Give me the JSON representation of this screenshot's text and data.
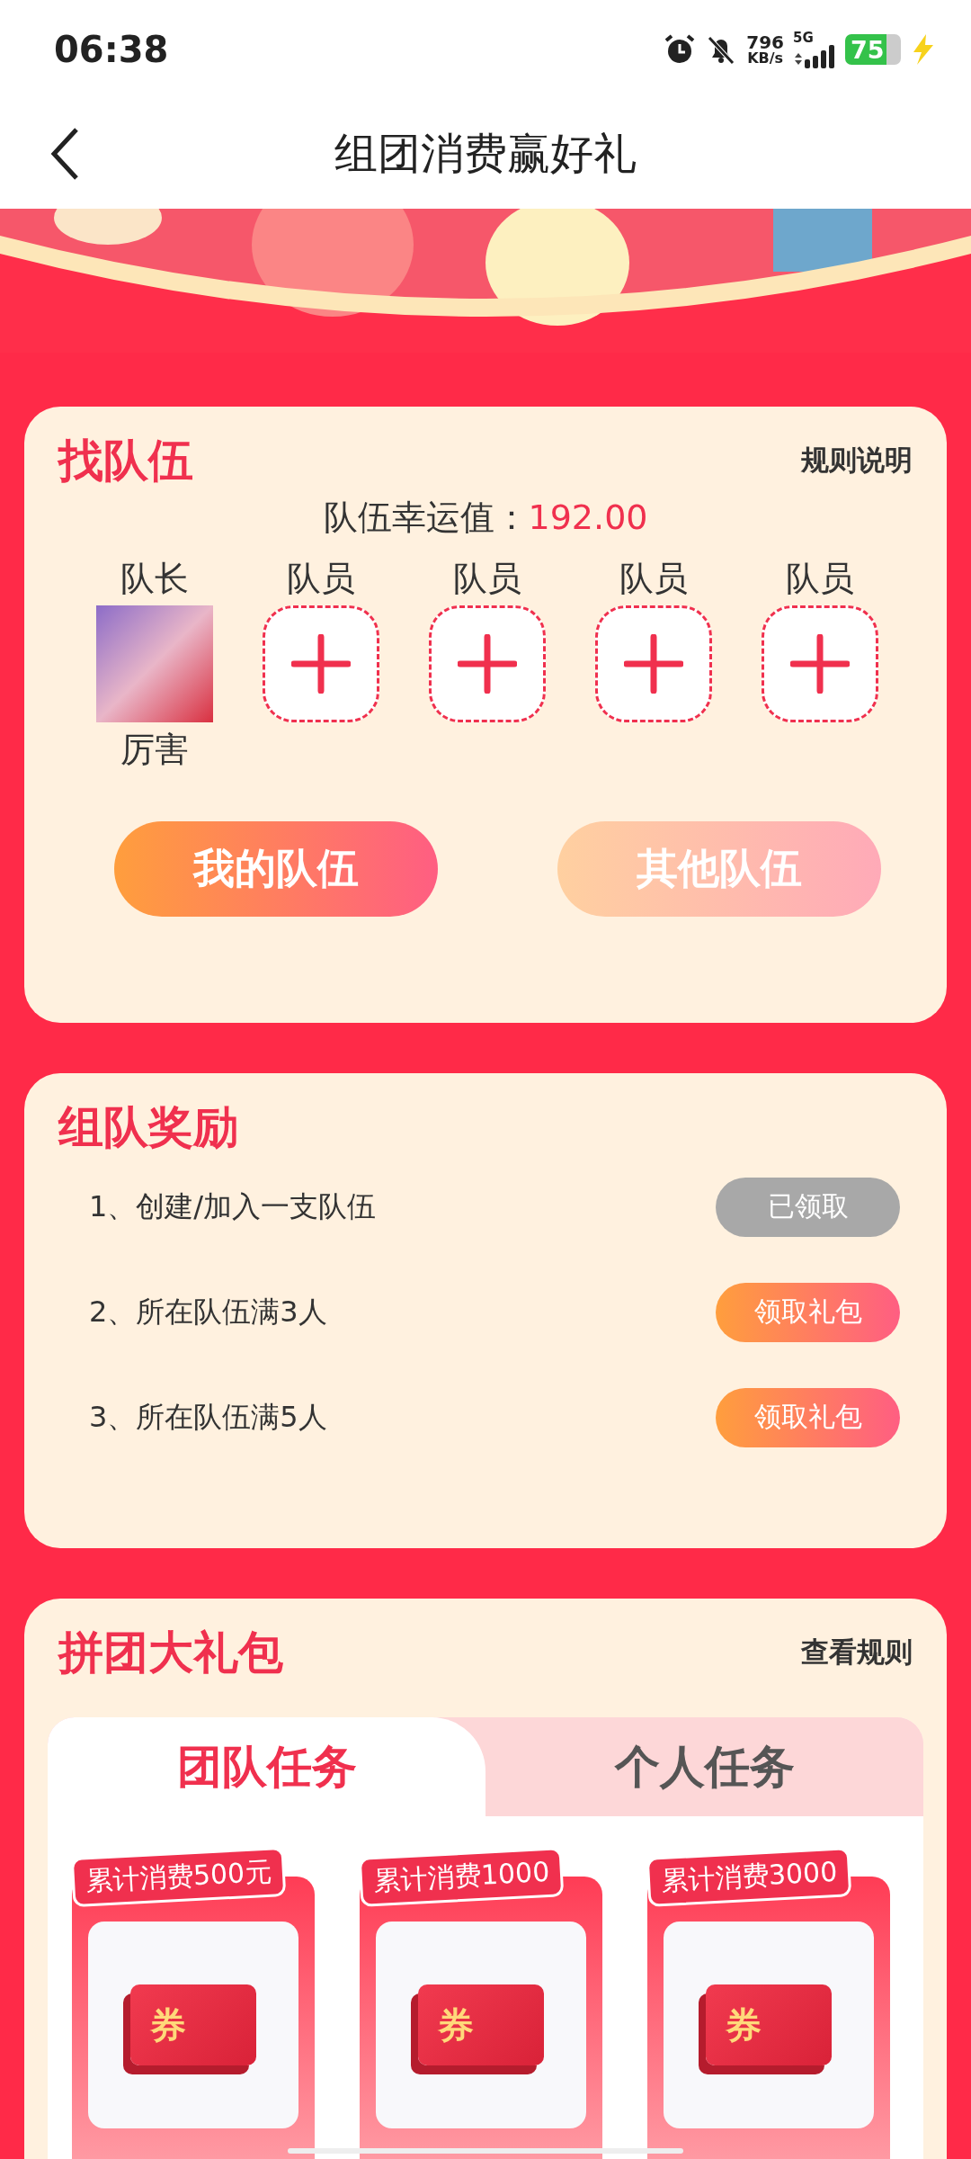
{
  "status_bar": {
    "time": "06:38",
    "speed_value": "796",
    "speed_unit": "KB/s",
    "network": "5G",
    "battery": "75"
  },
  "header": {
    "title": "组团消费赢好礼"
  },
  "team": {
    "title": "找队伍",
    "rules_link": "规则说明",
    "lucky_label": "队伍幸运值：",
    "lucky_value": "192.00",
    "members": [
      {
        "role": "队长",
        "kind": "leader",
        "name": "厉害"
      },
      {
        "role": "队员",
        "kind": "empty"
      },
      {
        "role": "队员",
        "kind": "empty"
      },
      {
        "role": "队员",
        "kind": "empty"
      },
      {
        "role": "队员",
        "kind": "empty"
      }
    ],
    "buttons": [
      {
        "label": "我的队伍",
        "selected": true
      },
      {
        "label": "其他队伍",
        "selected": false
      }
    ]
  },
  "rewards": {
    "title": "组队奖励",
    "items": [
      {
        "text": "1、创建/加入一支队伍",
        "button": "已领取",
        "claimed": true
      },
      {
        "text": "2、所在队伍满3人",
        "button": "领取礼包",
        "claimed": false
      },
      {
        "text": "3、所在队伍满5人",
        "button": "领取礼包",
        "claimed": false
      }
    ]
  },
  "gift": {
    "title": "拼团大礼包",
    "rules_link": "查看规则",
    "tabs": [
      {
        "label": "团队任务",
        "selected": true
      },
      {
        "label": "个人任务",
        "selected": false
      }
    ],
    "coupons": [
      {
        "threshold": "累计消费500元",
        "glyph": "券"
      },
      {
        "threshold": "累计消费1000",
        "glyph": "券"
      },
      {
        "threshold": "累计消费3000",
        "glyph": "券"
      }
    ]
  }
}
